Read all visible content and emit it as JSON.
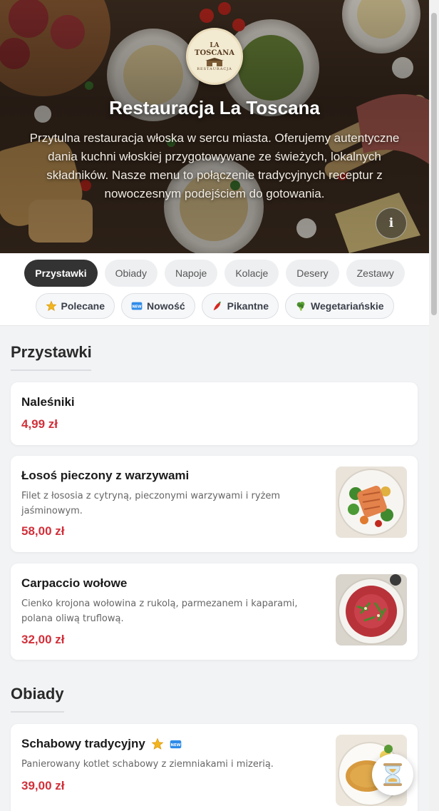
{
  "restaurant": {
    "logo_line1": "LA",
    "logo_line2": "TOSCANA",
    "logo_line3": "RESTAURACJA",
    "name": "Restauracja La Toscana",
    "description": "Przytulna restauracja włoska w sercu miasta. Oferujemy autentyczne dania kuchni włoskiej przygotowywane ze świeżych, lokalnych składników. Nasze menu to połączenie tradycyjnych receptur z nowoczesnym podejściem do gotowania.",
    "info_label": "i"
  },
  "categories": [
    {
      "label": "Przystawki",
      "active": true
    },
    {
      "label": "Obiady",
      "active": false
    },
    {
      "label": "Napoje",
      "active": false
    },
    {
      "label": "Kolacje",
      "active": false
    },
    {
      "label": "Desery",
      "active": false
    },
    {
      "label": "Zestawy",
      "active": false
    }
  ],
  "tags": [
    {
      "label": "Polecane",
      "icon": "star-icon"
    },
    {
      "label": "Nowość",
      "icon": "new-icon"
    },
    {
      "label": "Pikantne",
      "icon": "chili-icon"
    },
    {
      "label": "Wegetariańskie",
      "icon": "broccoli-icon"
    }
  ],
  "new_badge_text": "NEW",
  "sections": [
    {
      "title": "Przystawki",
      "items": [
        {
          "name": "Naleśniki",
          "price": "4,99 zł"
        },
        {
          "name": "Łosoś pieczony z warzywami",
          "description": "Filet z łososia z cytryną, pieczonymi warzywami i ryżem jaśminowym.",
          "price": "58,00 zł",
          "image": "salmon-dish"
        },
        {
          "name": "Carpaccio wołowe",
          "description": "Cienko krojona wołowina z rukolą, parmezanem i kaparami, polana oliwą truflową.",
          "price": "32,00 zł",
          "image": "carpaccio-dish"
        }
      ]
    },
    {
      "title": "Obiady",
      "items": [
        {
          "name": "Schabowy tradycyjny",
          "description": "Panierowany kotlet schabowy z ziemniakami i mizerią.",
          "price": "39,00 zł",
          "image": "schnitzel-dish",
          "badges": [
            "star-icon",
            "new-icon"
          ]
        }
      ]
    }
  ],
  "colors": {
    "price": "#d2303a",
    "active_category": "#333333"
  }
}
